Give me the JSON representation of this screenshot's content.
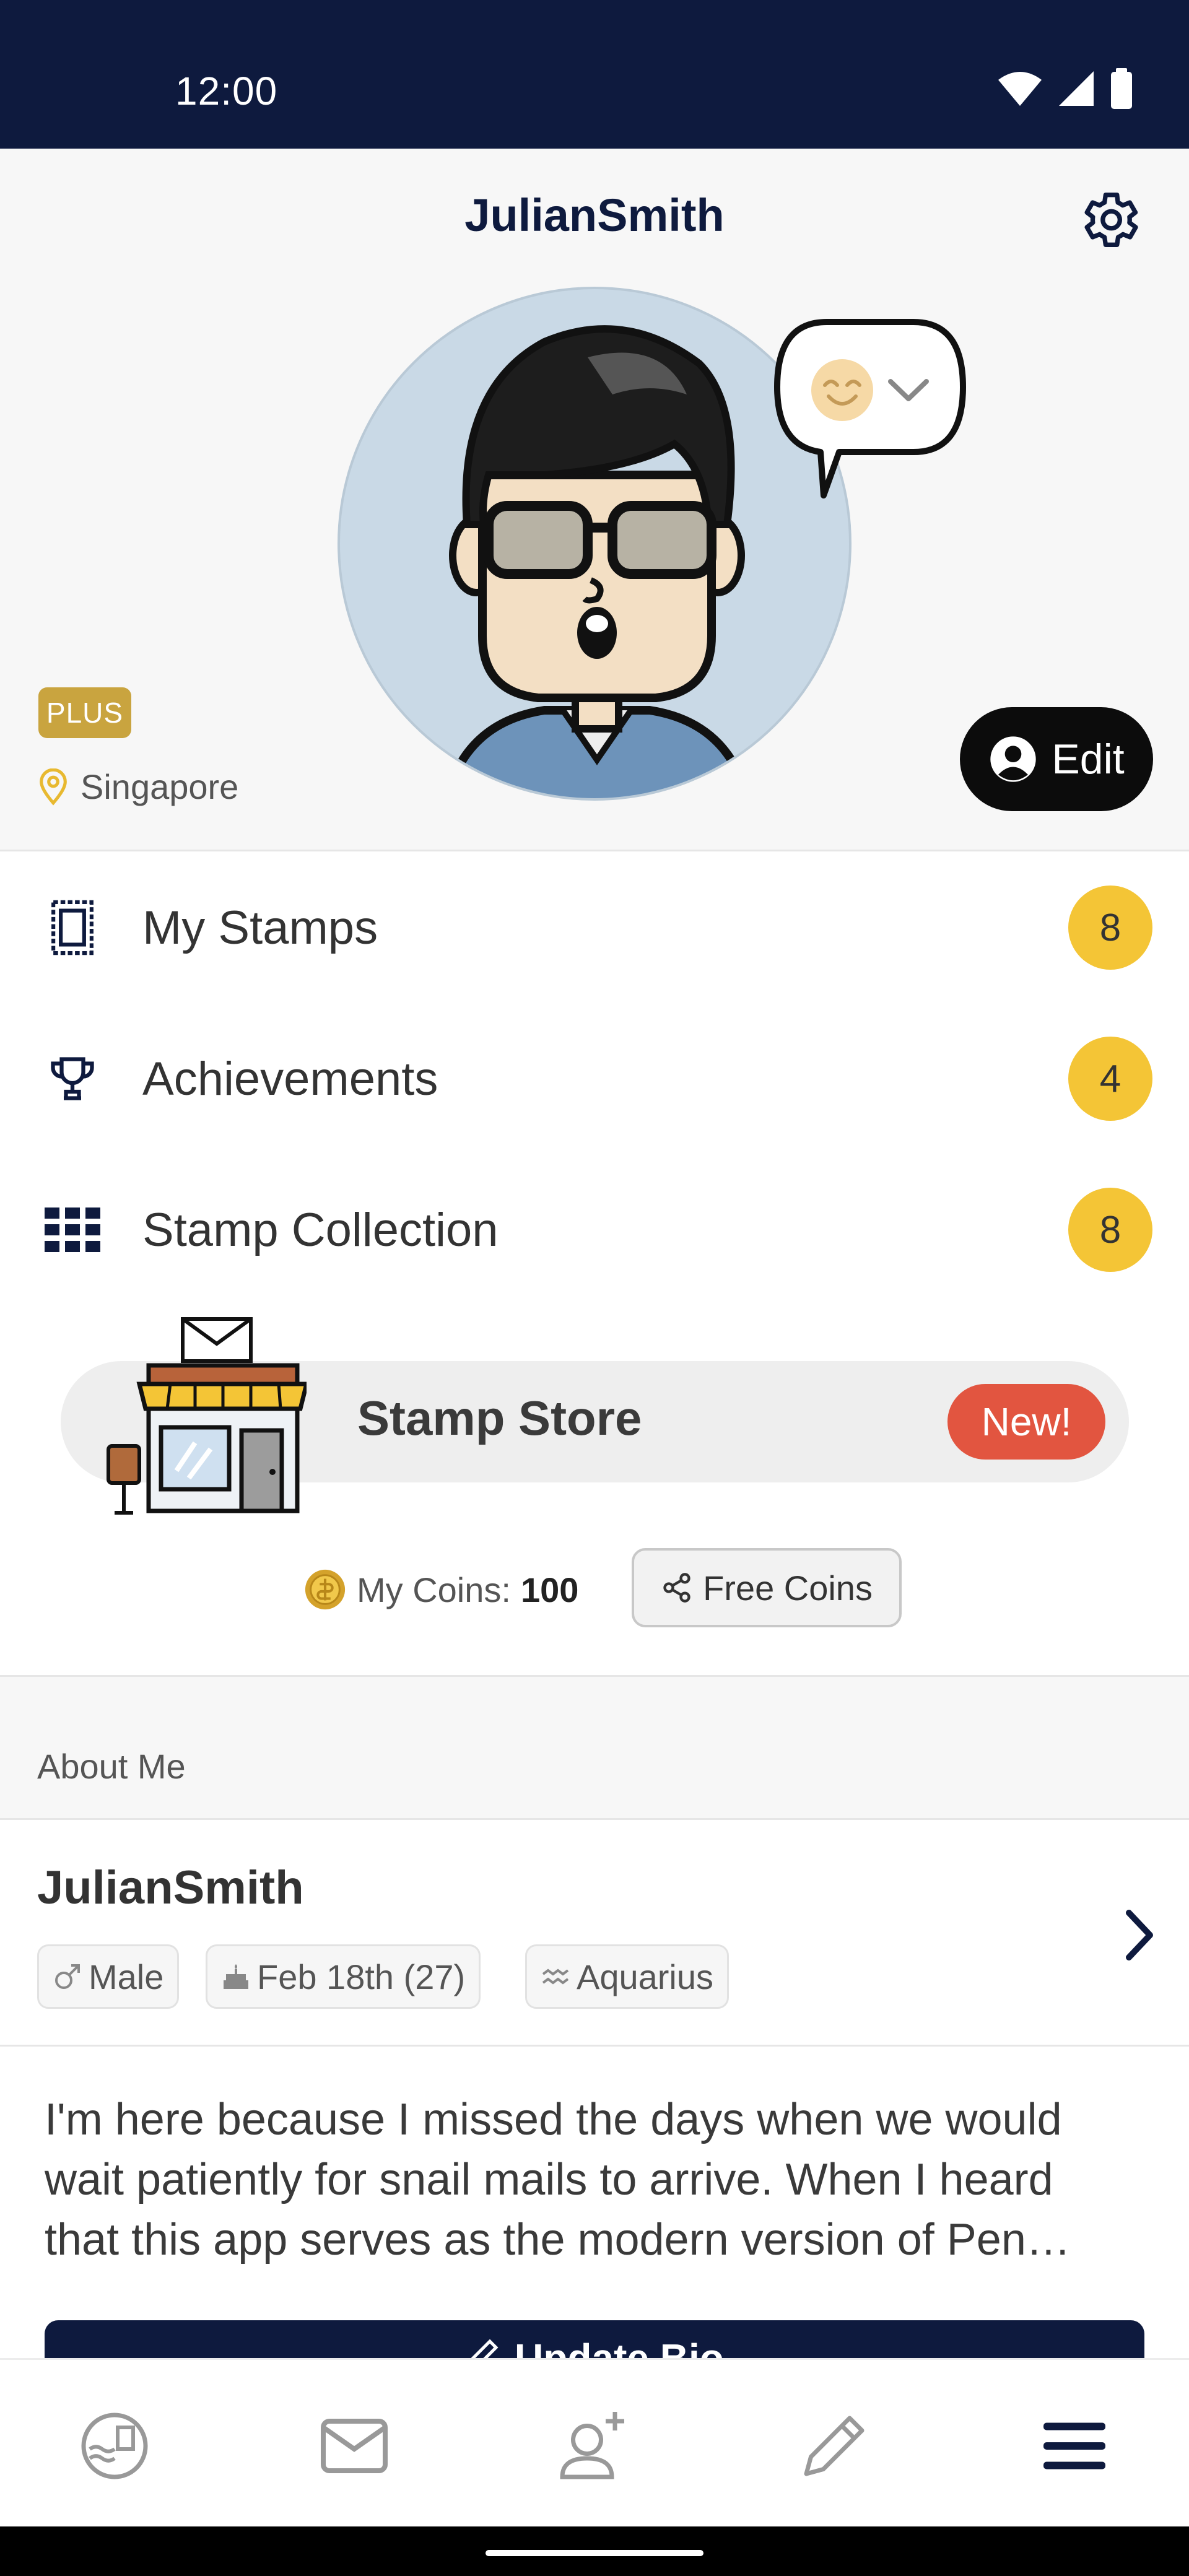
{
  "status_bar": {
    "time": "12:00"
  },
  "profile": {
    "username": "JulianSmith",
    "membership_badge": "PLUS",
    "location": "Singapore",
    "edit_label": "Edit",
    "mood": "smiling-face"
  },
  "menu": {
    "items": [
      {
        "label": "My Stamps",
        "count": "8",
        "icon": "stamp-icon"
      },
      {
        "label": "Achievements",
        "count": "4",
        "icon": "trophy-icon"
      },
      {
        "label": "Stamp Collection",
        "count": "8",
        "icon": "grid-icon"
      }
    ]
  },
  "store": {
    "label": "Stamp Store",
    "new_badge": "New!"
  },
  "coins": {
    "label": "My Coins:",
    "amount": "100",
    "free_coins_label": "Free Coins"
  },
  "about": {
    "section_title": "About Me",
    "name": "JulianSmith",
    "gender": "Male",
    "birthday": "Feb 18th (27)",
    "zodiac": "Aquarius",
    "bio_lines": [
      "I'm here because I missed the days when we would",
      "wait patiently for snail mails to arrive. When I heard",
      "that this app serves as the modern version of Pen…"
    ],
    "update_bio_label": "Update Bio"
  },
  "bottom_nav": {
    "items": [
      "nearby-icon",
      "mail-icon",
      "add-friend-icon",
      "write-icon",
      "menu-icon"
    ]
  },
  "colors": {
    "navy": "#0e1a3e",
    "badge_yellow": "#f4c536",
    "plus_gold": "#c9a43f",
    "new_red": "#e25540"
  }
}
